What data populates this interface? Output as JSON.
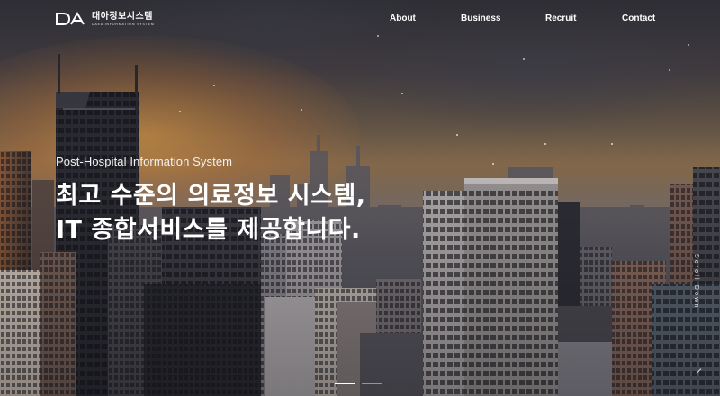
{
  "logo": {
    "mark": "DA",
    "name_ko": "대아정보시스템",
    "name_en": "DAEA INFORMATION SYSTEM"
  },
  "nav": {
    "items": [
      {
        "label": "About"
      },
      {
        "label": "Business"
      },
      {
        "label": "Recruit"
      },
      {
        "label": "Contact"
      }
    ]
  },
  "hero": {
    "subtitle": "Post-Hospital Information System",
    "headline_line1": "최고 수준의 의료정보 시스템,",
    "headline_line2": "IT 종합서비스를 제공합니다."
  },
  "scroll": {
    "label": "Scroll Down"
  },
  "slider": {
    "slides": 2,
    "active_index": 0
  },
  "colors": {
    "text": "#ffffff",
    "sky_warm": "#c8893f",
    "sky_cool": "#4a4c58"
  }
}
